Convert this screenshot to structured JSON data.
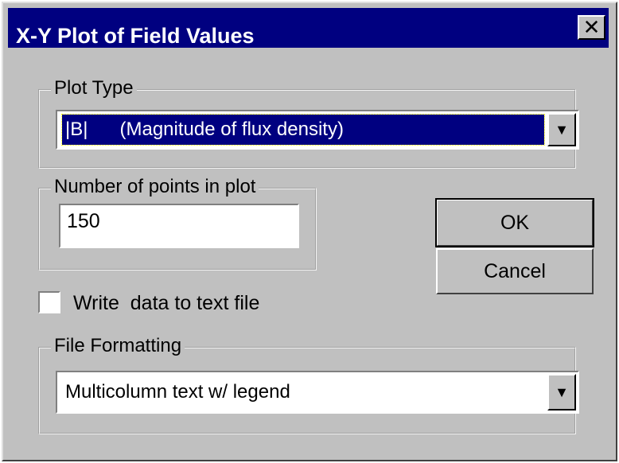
{
  "dialog": {
    "title": "X-Y Plot of Field Values",
    "close_glyph": "✕"
  },
  "plot_type": {
    "group_label": "Plot Type",
    "selected_value": "|B|      (Magnitude of flux density)"
  },
  "points": {
    "group_label": "Number of points in plot",
    "value": "150"
  },
  "buttons": {
    "ok_label": "OK",
    "cancel_label": "Cancel"
  },
  "write_file": {
    "label": "Write  data to text file",
    "checked": false
  },
  "file_formatting": {
    "group_label": "File Formatting",
    "selected_value": "Multicolumn text w/ legend"
  },
  "colors": {
    "titlebar": "#000080",
    "face": "#c0c0c0"
  }
}
